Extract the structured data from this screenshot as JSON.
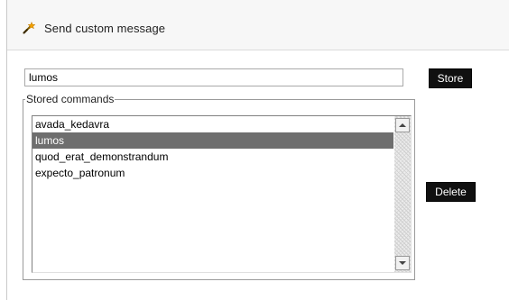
{
  "header": {
    "title": "Send custom message",
    "icon": "magic-wand-icon"
  },
  "command_input": {
    "value": "lumos"
  },
  "buttons": {
    "store_label": "Store",
    "delete_label": "Delete"
  },
  "stored_commands": {
    "legend": "Stored commands",
    "items": [
      "avada_kedavra",
      "lumos",
      "quod_erat_demonstrandum",
      "expecto_patronum"
    ],
    "selected_index": 1
  },
  "colors": {
    "button_bg": "#101010",
    "selected_bg": "#6e6e6e",
    "header_bg": "#f7f7f7"
  }
}
